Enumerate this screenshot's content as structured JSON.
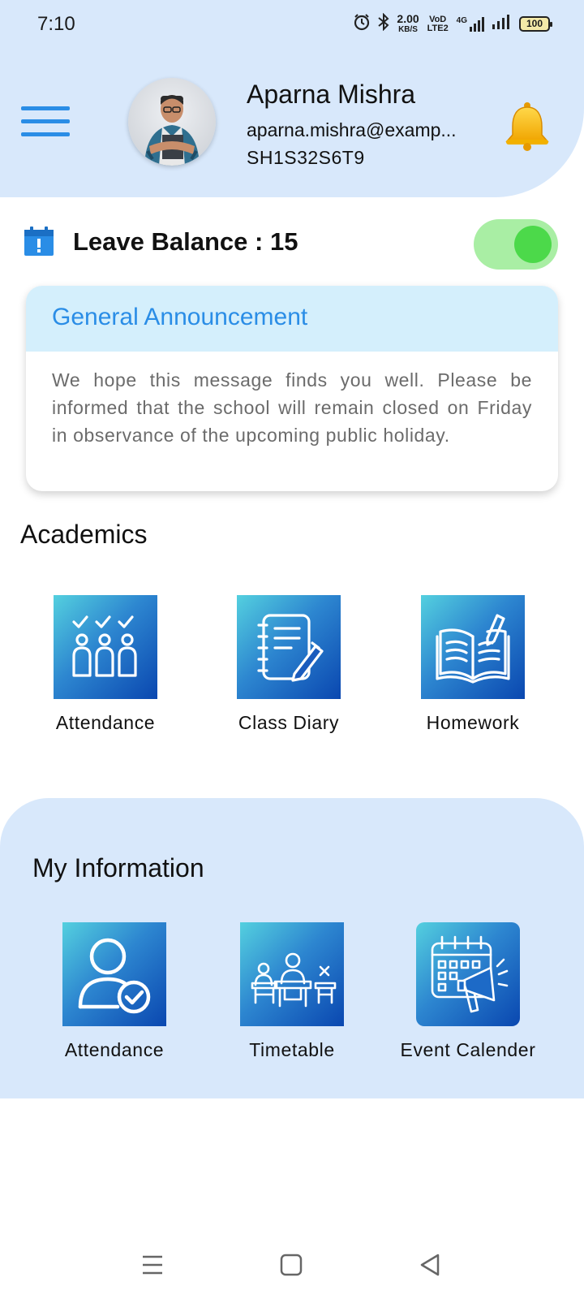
{
  "status_bar": {
    "time": "7:10",
    "speed_value": "2.00",
    "speed_unit": "KB/S",
    "volte": "VoD LTE2",
    "network": "4G",
    "battery": "100"
  },
  "header": {
    "name": "Aparna Mishra",
    "email": "aparna.mishra@examp...",
    "user_id": "SH1S32S6T9"
  },
  "leave": {
    "text": "Leave Balance : 15",
    "toggle_on": true
  },
  "announcement": {
    "title": "General Announcement",
    "body": "We hope this message finds you well. Please be informed that the school will remain closed on Friday in observance of the upcoming public holiday."
  },
  "academics": {
    "title": "Academics",
    "items": [
      {
        "label": "Attendance",
        "icon": "attendance-check-icon"
      },
      {
        "label": "Class Diary",
        "icon": "diary-pen-icon"
      },
      {
        "label": "Homework",
        "icon": "open-book-pen-icon"
      }
    ]
  },
  "my_information": {
    "title": "My Information",
    "items": [
      {
        "label": "Attendance",
        "icon": "user-check-icon"
      },
      {
        "label": "Timetable",
        "icon": "classroom-desk-icon"
      },
      {
        "label": "Event Calender",
        "icon": "calendar-megaphone-icon"
      }
    ]
  },
  "colors": {
    "header_bg": "#d8e8fb",
    "accent_blue": "#2a8de6",
    "toggle_track": "#a9eea4",
    "toggle_knob": "#4cd94a",
    "tile_gradient_start": "#54d0df",
    "tile_gradient_end": "#0a47b0"
  }
}
